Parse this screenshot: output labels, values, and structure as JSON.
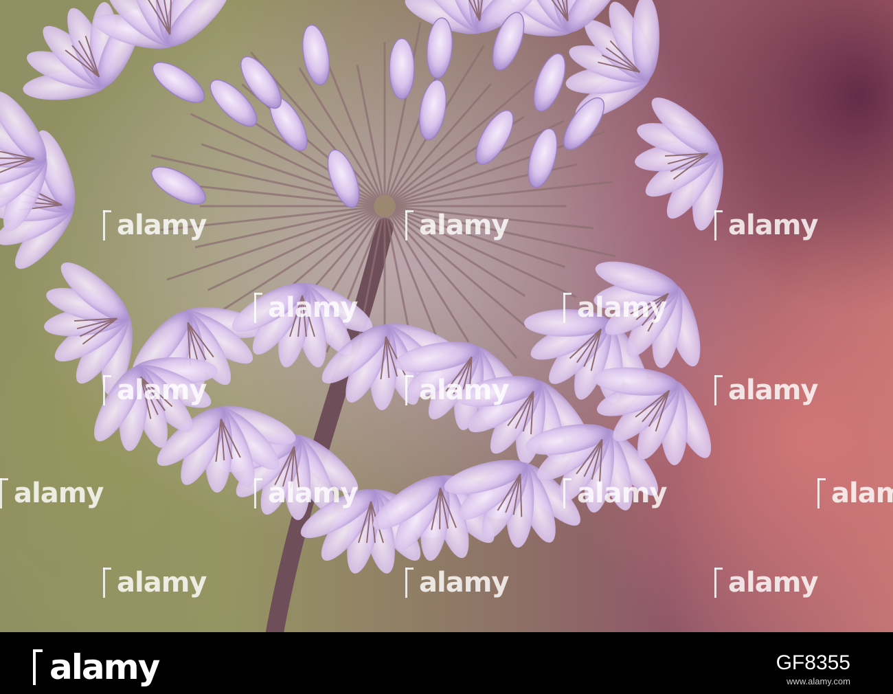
{
  "image": {
    "subject": "agapanthus-flower-head",
    "colors": {
      "petal": "#d9c3ec",
      "petal_shadow": "#a98fd0",
      "stem": "#6e4e58",
      "background_green": "#8e8f63",
      "background_pink": "#c27474"
    }
  },
  "watermark": {
    "text": "alamy"
  },
  "footer": {
    "brand": "alamy",
    "image_id": "GF8355",
    "url": "www.alamy.com"
  }
}
